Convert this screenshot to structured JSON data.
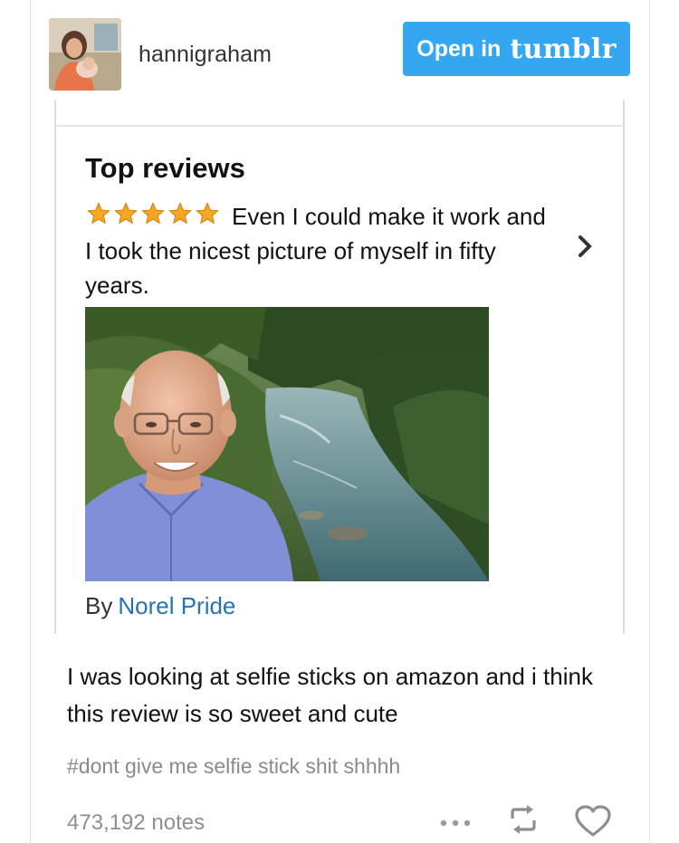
{
  "header": {
    "username": "hannigraham",
    "open_button": {
      "text": "Open in",
      "brand": "tumblr"
    }
  },
  "review": {
    "heading": "Top reviews",
    "rating_stars": 5,
    "text": "Even I could make it work and I took the nicest picture of myself in fifty years.",
    "by_label": "By",
    "author": "Norel Pride"
  },
  "post": {
    "caption": "I was looking at selfie sticks on amazon and i think this review is so sweet and cute",
    "tags": "#dont give me selfie stick shit shhhh"
  },
  "footer": {
    "notes": "473,192 notes",
    "icons": [
      "more-icon",
      "reblog-icon",
      "heart-icon"
    ]
  },
  "colors": {
    "tumblr_blue": "#35a6f2",
    "author_link": "#2573b3",
    "star_gold": "#f5a623"
  }
}
